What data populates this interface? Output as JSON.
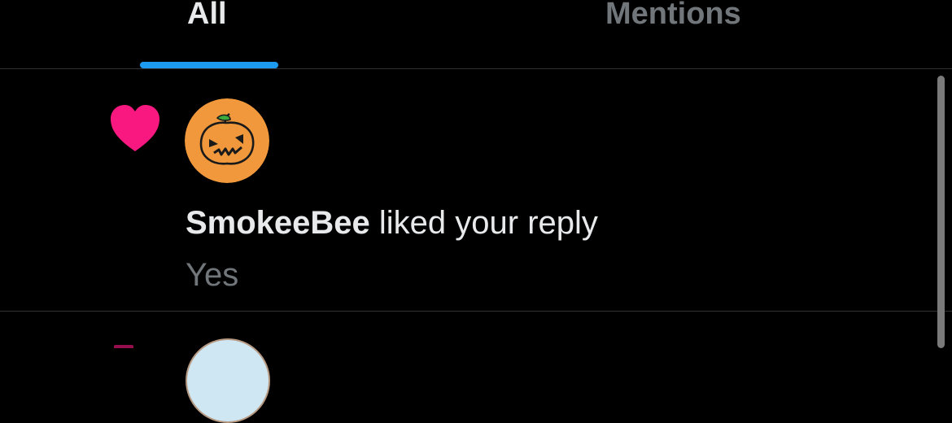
{
  "tabs": [
    {
      "label": "All",
      "active": true
    },
    {
      "label": "Mentions",
      "active": false
    }
  ],
  "notification": {
    "icon": "heart-icon",
    "icon_color": "#f91880",
    "avatar": "pumpkin-avatar",
    "user": "SmokeeBee",
    "action": " liked your reply",
    "snippet": "Yes"
  },
  "colors": {
    "background": "#000000",
    "accent": "#1d9bf0",
    "primary_text": "#e7e9ea",
    "secondary_text": "#71767b",
    "like": "#f91880"
  }
}
